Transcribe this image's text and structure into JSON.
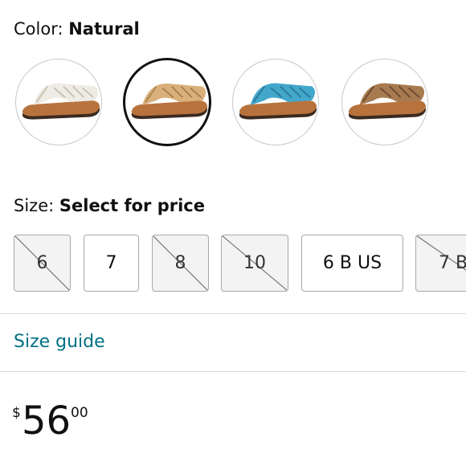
{
  "color": {
    "label": "Color:",
    "selected": "Natural",
    "swatches": [
      {
        "name": "White",
        "strap_color": "#eeece4",
        "sole_color": "#b8733d",
        "selected": false
      },
      {
        "name": "Natural",
        "strap_color": "#d9b07a",
        "sole_color": "#b8733d",
        "selected": true
      },
      {
        "name": "Turquoise",
        "strap_color": "#43a7cc",
        "sole_color": "#b8733d",
        "selected": false
      },
      {
        "name": "Brown",
        "strap_color": "#a87a50",
        "sole_color": "#b8733d",
        "selected": false
      }
    ]
  },
  "size": {
    "label": "Size:",
    "selected": "Select for price",
    "options": [
      {
        "label": "6",
        "available": false
      },
      {
        "label": "7",
        "available": true
      },
      {
        "label": "8",
        "available": false
      },
      {
        "label": "10",
        "available": false
      },
      {
        "label": "6 B US",
        "available": true
      },
      {
        "label": "7 B",
        "available": false
      }
    ]
  },
  "size_guide": "Size guide",
  "price": {
    "symbol": "$",
    "whole": "56",
    "fraction": "00"
  },
  "colors": {
    "link": "#007185",
    "text": "#0f1111",
    "divider": "#d5d9d9"
  }
}
